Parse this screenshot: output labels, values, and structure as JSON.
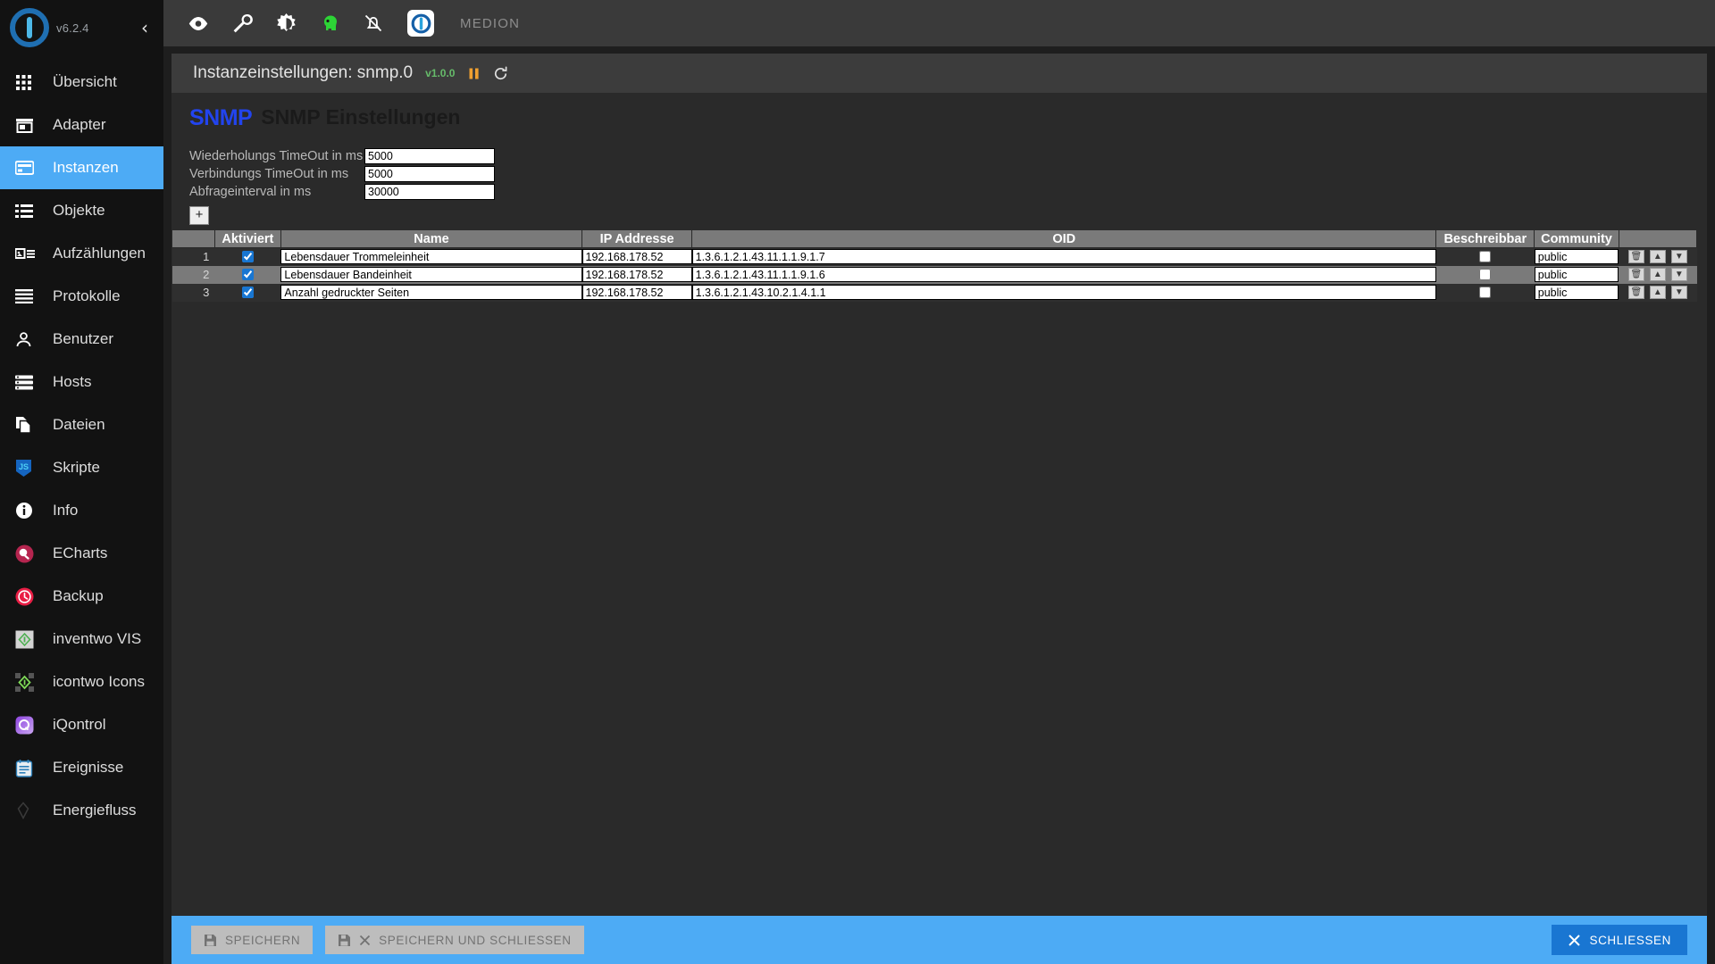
{
  "sidebar": {
    "version": "v6.2.4",
    "collapse_label": "‹",
    "items": [
      {
        "label": "Übersicht",
        "icon": "grid-icon",
        "active": false
      },
      {
        "label": "Adapter",
        "icon": "store-icon",
        "active": false
      },
      {
        "label": "Instanzen",
        "icon": "instances-icon",
        "active": true
      },
      {
        "label": "Objekte",
        "icon": "list-icon",
        "active": false
      },
      {
        "label": "Aufzählungen",
        "icon": "enum-icon",
        "active": false
      },
      {
        "label": "Protokolle",
        "icon": "log-icon",
        "active": false
      },
      {
        "label": "Benutzer",
        "icon": "user-icon",
        "active": false
      },
      {
        "label": "Hosts",
        "icon": "hosts-icon",
        "active": false
      },
      {
        "label": "Dateien",
        "icon": "files-icon",
        "active": false
      },
      {
        "label": "Skripte",
        "icon": "javascript-icon",
        "active": false
      },
      {
        "label": "Info",
        "icon": "info-icon",
        "active": false
      },
      {
        "label": "ECharts",
        "icon": "echarts-icon",
        "active": false
      },
      {
        "label": "Backup",
        "icon": "backup-icon",
        "active": false
      },
      {
        "label": "inventwo VIS",
        "icon": "inventwo-icon",
        "active": false
      },
      {
        "label": "icontwo Icons",
        "icon": "icontwo-icon",
        "active": false
      },
      {
        "label": "iQontrol",
        "icon": "iqontrol-icon",
        "active": false
      },
      {
        "label": "Ereignisse",
        "icon": "events-icon",
        "active": false
      },
      {
        "label": "Energiefluss",
        "icon": "energy-icon",
        "active": false
      }
    ]
  },
  "topbar": {
    "icons": [
      "eye-icon",
      "wrench-icon",
      "brightness-icon",
      "expert-mode-icon",
      "notifications-off-icon"
    ],
    "logo_icon": "iobroker-logo-icon",
    "host": "MEDION"
  },
  "panel": {
    "title": "Instanzeinstellungen: snmp.0",
    "version": "v1.0.0",
    "pause_icon": "pause-icon",
    "refresh_icon": "refresh-icon"
  },
  "config": {
    "logo_text": "SNMP",
    "heading": "SNMP Einstellungen",
    "fields": [
      {
        "label": "Wiederholungs TimeOut in ms",
        "value": "5000"
      },
      {
        "label": "Verbindungs TimeOut in ms",
        "value": "5000"
      },
      {
        "label": "Abfrageinterval in ms",
        "value": "30000"
      }
    ],
    "add_button_label": "+"
  },
  "table": {
    "columns": [
      "",
      "Aktiviert",
      "Name",
      "IP Addresse",
      "OID",
      "Beschreibbar",
      "Community",
      ""
    ],
    "rows": [
      {
        "index": "1",
        "aktiviert": true,
        "name": "Lebensdauer Trommeleinheit",
        "ip": "192.168.178.52",
        "oid": "1.3.6.1.2.1.43.11.1.1.9.1.7",
        "beschreibbar": false,
        "community": "public",
        "selected": false
      },
      {
        "index": "2",
        "aktiviert": true,
        "name": "Lebensdauer Bandeinheit",
        "ip": "192.168.178.52",
        "oid": "1.3.6.1.2.1.43.11.1.1.9.1.6",
        "beschreibbar": false,
        "community": "public",
        "selected": true
      },
      {
        "index": "3",
        "aktiviert": true,
        "name": "Anzahl gedruckter Seiten",
        "ip": "192.168.178.52",
        "oid": "1.3.6.1.2.1.43.10.2.1.4.1.1",
        "beschreibbar": false,
        "community": "public",
        "selected": false
      }
    ],
    "row_buttons": [
      "delete-icon",
      "move-up-icon",
      "move-down-icon"
    ]
  },
  "footer": {
    "save_label": "SPEICHERN",
    "save_close_label": "SPEICHERN UND SCHLIESSEN",
    "close_label": "SCHLIESSEN"
  },
  "colors": {
    "accent": "#4dabf5",
    "footer_close": "#1976d2",
    "version_badge": "#66bb6a",
    "snmp_logo": "#2244ee",
    "sidebar_bg": "#121212"
  }
}
